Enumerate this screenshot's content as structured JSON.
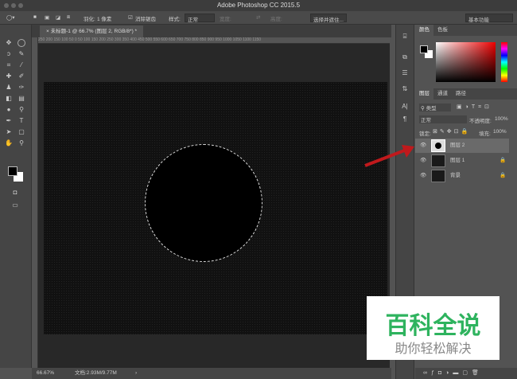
{
  "app": {
    "title": "Adobe Photoshop CC 2015.5"
  },
  "options": {
    "feather_label": "羽化:",
    "feather_value": "1 像素",
    "antialias_label": "消除锯齿",
    "style_label": "样式:",
    "style_value": "正常",
    "width_label": "宽度:",
    "height_label": "高度:",
    "select_mask_button": "选择并遮住...",
    "workspace": "基本功能"
  },
  "document": {
    "tab_title": "未标题-1 @ 66.7% (图层 2, RGB/8*) *",
    "ruler_ticks": "250 200 150 100 50 0 50 100 150 200 250 300 350 400 450 500 550 600 650 700 750 800 850 900 950 1000 1050 1100 1150"
  },
  "status": {
    "zoom": "66.67%",
    "doc_size": "文档:2.93M/9.77M"
  },
  "color_panel": {
    "tabs": [
      "颜色",
      "色板"
    ]
  },
  "layers_panel": {
    "tabs": [
      "图层",
      "通道",
      "路径"
    ],
    "filter_kind": "类型",
    "blend_mode": "正常",
    "opacity_label": "不透明度:",
    "opacity_value": "100%",
    "lock_label": "锁定:",
    "fill_label": "填充:",
    "fill_value": "100%",
    "layers": [
      {
        "name": "图层 2",
        "selected": true
      },
      {
        "name": "图层 1",
        "locked": true
      },
      {
        "name": "背景",
        "locked": true
      }
    ]
  },
  "watermark": {
    "line1": "百科全说",
    "line2": "助你轻松解决"
  },
  "colors": {
    "accent_arrow": "#c0191c",
    "watermark_green": "#2eb35e"
  }
}
